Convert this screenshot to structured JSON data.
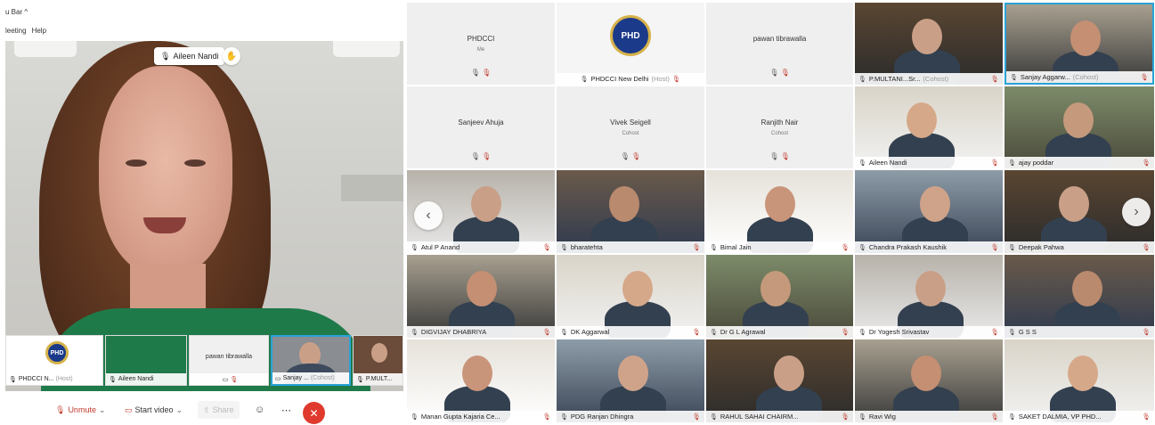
{
  "left": {
    "menu_head": "u Bar ^",
    "menu_items": [
      "leeting",
      "Help"
    ],
    "speaker_name": "Aileen Nandi",
    "strip": [
      {
        "label": "PHDCCI N...",
        "host": "(Host)",
        "logo": "PHD"
      },
      {
        "label": "Aileen Nandi"
      },
      {
        "label": "",
        "center": "pawan tibrawalla"
      },
      {
        "label": "Sanjay ...",
        "host": "(Cohost)"
      },
      {
        "label": "P.MULT..."
      }
    ],
    "toolbar": {
      "unmute": "Unmute",
      "start_video": "Start video",
      "share": "Share"
    }
  },
  "gallery": {
    "rows": [
      [
        {
          "type": "plain",
          "name": "PHDCCI",
          "sub": "Me"
        },
        {
          "type": "logo",
          "label": "PHDCCI New Delhi",
          "host": "(Host)",
          "logo": "PHD"
        },
        {
          "type": "plain",
          "name": "pawan tibrawalla",
          "sub": ""
        },
        {
          "type": "video",
          "label": "P.MULTANI...Sr...",
          "host": "(Cohost)"
        },
        {
          "type": "video",
          "label": "Sanjay Aggarw...",
          "host": "(Cohost)",
          "selected": true
        }
      ],
      [
        {
          "type": "plain",
          "name": "Sanjeev Ahuja",
          "sub": ""
        },
        {
          "type": "plain",
          "name": "Vivek Seigell",
          "sub": "Cohost"
        },
        {
          "type": "plain",
          "name": "Ranjith Nair",
          "sub": "Cohost"
        },
        {
          "type": "video",
          "label": "Aileen Nandi"
        },
        {
          "type": "video",
          "label": "ajay poddar"
        }
      ],
      [
        {
          "type": "video",
          "label": "Atul P Anand"
        },
        {
          "type": "video",
          "label": "bharatehta"
        },
        {
          "type": "video",
          "label": "Bimal Jain"
        },
        {
          "type": "video",
          "label": "Chandra Prakash Kaushik"
        },
        {
          "type": "video",
          "label": "Deepak Pahwa"
        }
      ],
      [
        {
          "type": "video",
          "label": "DIGVIJAY DHABRIYA"
        },
        {
          "type": "video",
          "label": "DK Aggarwal"
        },
        {
          "type": "video",
          "label": "Dr G L Agrawal"
        },
        {
          "type": "video",
          "label": "Dr Yogesh Srivastav"
        },
        {
          "type": "video",
          "label": "G S S"
        }
      ],
      [
        {
          "type": "video",
          "label": "Manan Gupta Kajaria Ce..."
        },
        {
          "type": "video",
          "label": "PDG Ranjan Dhingra"
        },
        {
          "type": "video",
          "label": "RAHUL SAHAI CHAIRM..."
        },
        {
          "type": "video",
          "label": "Ravi Wig"
        },
        {
          "type": "video",
          "label": "SAKET DALMIA, VP PHD..."
        }
      ]
    ]
  },
  "colors": {
    "accent_blue": "#29a3d6",
    "mute_red": "#c0392b",
    "end_red": "#e03a2e",
    "shirt_green": "#1f7a4a"
  },
  "icons": [
    "chevron-left-icon",
    "chevron-right-icon",
    "mic-icon",
    "mic-muted-icon",
    "video-off-icon",
    "hand-icon",
    "pin-icon",
    "close-icon",
    "emoji-icon",
    "more-icon"
  ]
}
